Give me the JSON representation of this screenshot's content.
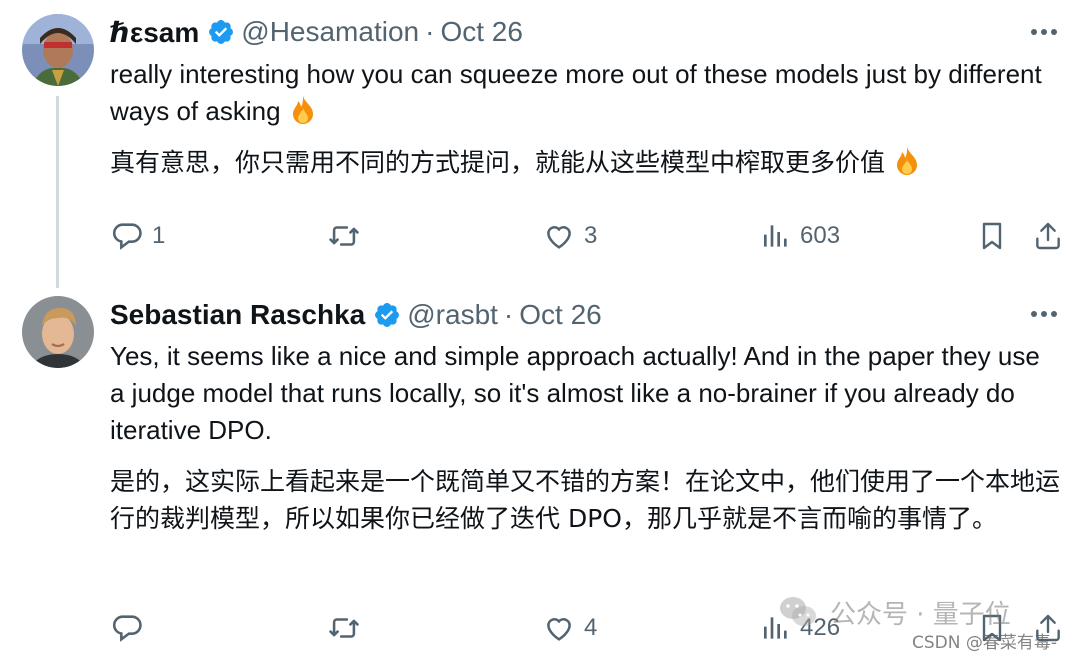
{
  "colors": {
    "text": "#0f1419",
    "secondary": "#536471",
    "verified": "#1d9bf0",
    "thread_line": "#cfd9de"
  },
  "tweets": [
    {
      "display_name": "ℏεsam",
      "handle": "@Hesamation",
      "separator": "·",
      "date": "Oct 26",
      "text_en": "really interesting how you  can squeeze more out of these models just by different ways of asking",
      "text_zh": "真有意思，你只需用不同的方式提问，就能从这些模型中榨取更多价值",
      "emoji_en": "fire-emoji",
      "emoji_zh": "fire-emoji",
      "replies": "1",
      "reposts": "",
      "likes": "3",
      "views": "603"
    },
    {
      "display_name": "Sebastian Raschka",
      "handle": "@rasbt",
      "separator": "·",
      "date": "Oct 26",
      "text_en": "Yes, it seems like a nice and simple approach actually! And in the paper they use a judge model that runs locally, so it's almost like a no-brainer if you already do iterative DPO.",
      "text_zh": "是的，这实际上看起来是一个既简单又不错的方案！在论文中，他们使用了一个本地运行的裁判模型，所以如果你已经做了迭代 DPO，那几乎就是不言而喻的事情了。",
      "replies": "",
      "reposts": "",
      "likes": "4",
      "views": "426"
    }
  ],
  "watermark": {
    "label": "公众号 · 量子位",
    "icon": "wechat-icon"
  },
  "credit": "CSDN @春菜有毒-"
}
